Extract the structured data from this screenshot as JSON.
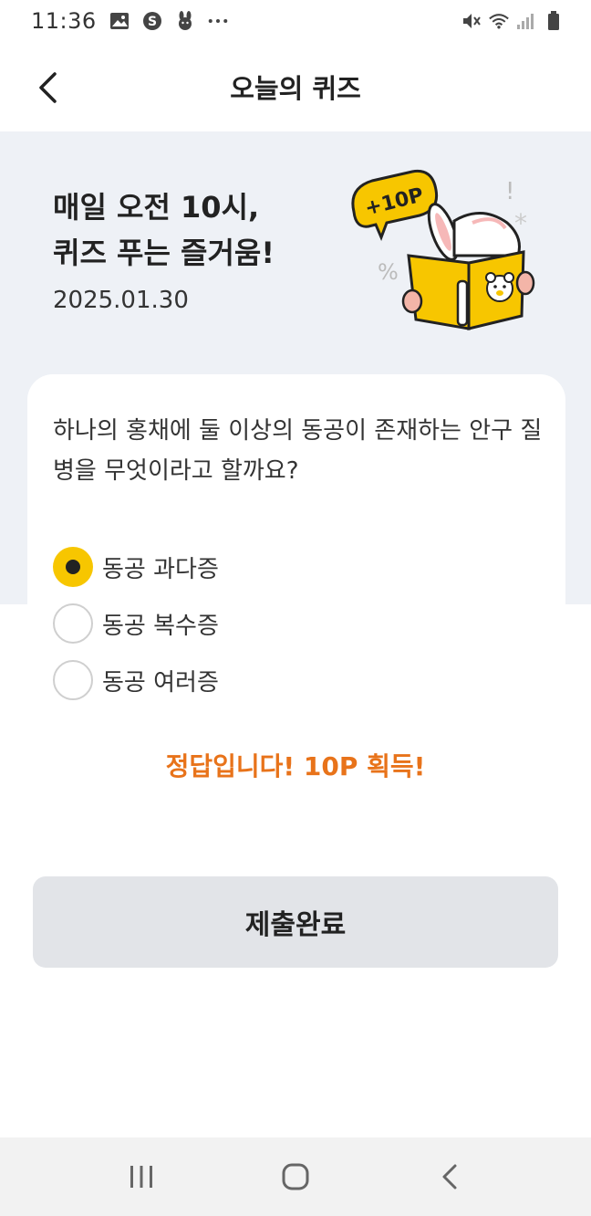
{
  "status_bar": {
    "time": "11:36",
    "left_icons": [
      "image-icon",
      "s-app-icon",
      "rabbit-icon",
      "more-dots-icon"
    ],
    "right_icons": [
      "mute-icon",
      "wifi-icon",
      "signal-icon",
      "battery-icon"
    ]
  },
  "header": {
    "title": "오늘의 퀴즈",
    "back_icon": "chevron-left-icon"
  },
  "hero": {
    "title_line1": "매일 오전 10시,",
    "title_line2": "퀴즈 푸는 즐거움!",
    "date": "2025.01.30",
    "badge": "+10P"
  },
  "quiz": {
    "question": "하나의 홍채에 둘 이상의 동공이 존재하는 안구 질병을 무엇이라고 할까요?",
    "options": [
      {
        "label": "동공 과다증",
        "selected": true
      },
      {
        "label": "동공 복수증",
        "selected": false
      },
      {
        "label": "동공 여러증",
        "selected": false
      }
    ],
    "result": "정답입니다! 10P 획득!",
    "submit_label": "제출완료"
  },
  "colors": {
    "accent_yellow": "#f7c600",
    "result_orange": "#e8731a",
    "hero_bg": "#eef1f6",
    "button_bg": "#e2e4e8"
  },
  "nav_bar": {
    "icons": [
      "recent-apps-icon",
      "home-icon",
      "back-icon"
    ]
  }
}
